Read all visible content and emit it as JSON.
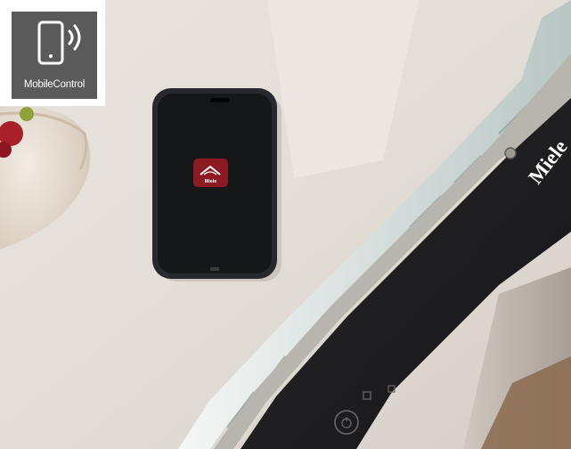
{
  "badge": {
    "label": "MobileControl",
    "icon": "smartphone-wireless-icon",
    "background": "#5a5a5a"
  },
  "phone": {
    "app_icon": "miele-app-icon",
    "app_icon_color": "#8c1a22",
    "app_icon_text": "Miele"
  },
  "dishwasher": {
    "brand": "Miele",
    "control_icon": "power-icon"
  }
}
